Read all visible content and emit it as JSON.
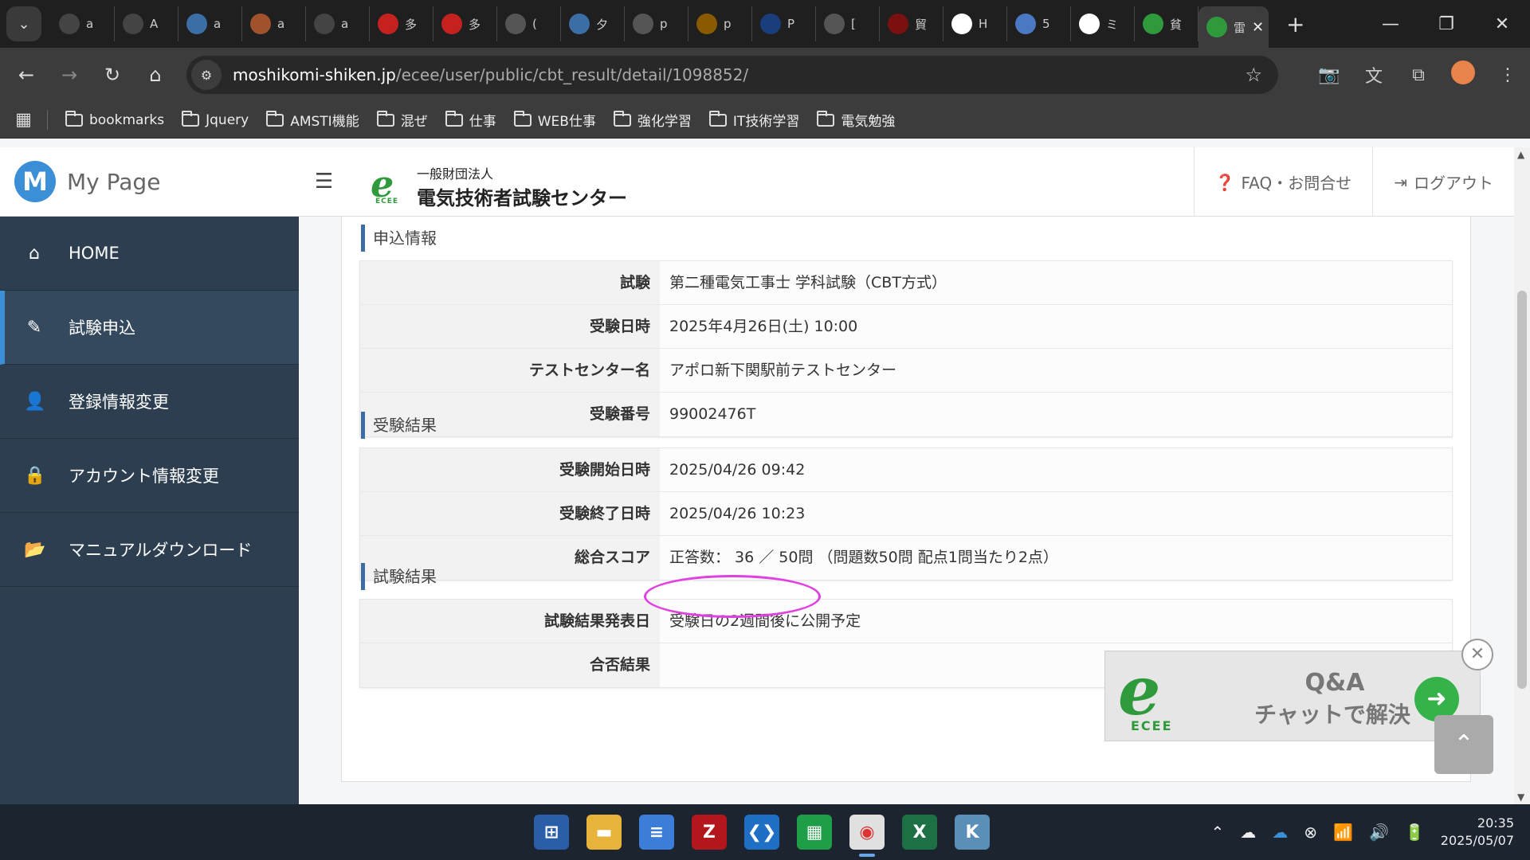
{
  "browser": {
    "tabs": [
      {
        "letter": "a",
        "icon": "threads-icon",
        "bg": "#444"
      },
      {
        "letter": "A",
        "icon": "threads-icon",
        "bg": "#444"
      },
      {
        "letter": "a",
        "icon": "wordpress-icon",
        "bg": "#3a6ea5"
      },
      {
        "letter": "a",
        "icon": "bicycle-icon",
        "bg": "#a0522d"
      },
      {
        "letter": "a",
        "icon": "threads-icon",
        "bg": "#444"
      },
      {
        "letter": "多",
        "icon": "gmail-icon",
        "bg": "#c5221f"
      },
      {
        "letter": "多",
        "icon": "gmail-icon",
        "bg": "#c5221f"
      },
      {
        "letter": "(",
        "icon": "globe-icon",
        "bg": "#555"
      },
      {
        "letter": "夕",
        "icon": "wordpress-icon",
        "bg": "#3a6ea5"
      },
      {
        "letter": "p",
        "icon": "globe-icon",
        "bg": "#555"
      },
      {
        "letter": "p",
        "icon": "mountain-icon",
        "bg": "#8a5a00"
      },
      {
        "letter": "P",
        "icon": "tp-icon",
        "bg": "#1a3d7c"
      },
      {
        "letter": "[",
        "icon": "globe-icon",
        "bg": "#555"
      },
      {
        "letter": "貿",
        "icon": "triangle-icon",
        "bg": "#7a1010"
      },
      {
        "letter": "H",
        "icon": "google-icon",
        "bg": "#fff"
      },
      {
        "letter": "5",
        "icon": "calendar-icon",
        "bg": "#4a78c2"
      },
      {
        "letter": "ミ",
        "icon": "amazon-icon",
        "bg": "#fff"
      },
      {
        "letter": "貧",
        "icon": "ecce-icon",
        "bg": "#2e9a3c"
      },
      {
        "letter": "雷",
        "icon": "ecce-icon",
        "bg": "#2e9a3c"
      }
    ],
    "url_host": "moshikomi-shiken.jp",
    "url_path": "/ecee/user/public/cbt_result/detail/1098852/",
    "bookmarks": [
      "bookmarks",
      "Jquery",
      "AMSTI機能",
      "混ぜ",
      "仕事",
      "WEB仕事",
      "強化学習",
      "IT技術学習",
      "電気勉強"
    ]
  },
  "sidebar": {
    "brand_letter": "M",
    "brand": "My Page",
    "items": [
      {
        "label": "HOME",
        "icon": "home-icon",
        "glyph": "⌂",
        "active": false
      },
      {
        "label": "試験申込",
        "icon": "pencil-icon",
        "glyph": "✎",
        "active": true
      },
      {
        "label": "登録情報変更",
        "icon": "user-icon",
        "glyph": "👤",
        "active": false
      },
      {
        "label": "アカウント情報変更",
        "icon": "lock-icon",
        "glyph": "🔒",
        "active": false
      },
      {
        "label": "マニュアルダウンロード",
        "icon": "folder-open-icon",
        "glyph": "📂",
        "active": false
      }
    ]
  },
  "header": {
    "org_sub": "一般財団法人",
    "org_main": "電気技術者試験センター",
    "org_abbr": "ECEE",
    "faq": "FAQ・お問合せ",
    "logout": "ログアウト"
  },
  "sections": [
    {
      "title": "申込情報",
      "rows": [
        {
          "label": "試験",
          "value": "第二種電気工事士 学科試験（CBT方式）"
        },
        {
          "label": "受験日時",
          "value": "2025年4月26日(土) 10:00"
        },
        {
          "label": "テストセンター名",
          "value": "アポロ新下関駅前テストセンター"
        },
        {
          "label": "受験番号",
          "value": "99002476T"
        }
      ]
    },
    {
      "title": "受験結果",
      "rows": [
        {
          "label": "受験開始日時",
          "value": "2025/04/26 09:42"
        },
        {
          "label": "受験終了日時",
          "value": "2025/04/26 10:23"
        },
        {
          "label": "総合スコア",
          "value": "正答数： 36 ／ 50問 （問題数50問 配点1問当たり2点）"
        }
      ]
    },
    {
      "title": "試験結果",
      "rows": [
        {
          "label": "試験結果発表日",
          "value": "受験日の2週間後に公開予定"
        },
        {
          "label": "合否結果",
          "value": ""
        }
      ]
    }
  ],
  "chat": {
    "abbr": "ECEE",
    "line1": "Q&A",
    "line2": "チャットで解決"
  },
  "taskbar": {
    "time": "20:35",
    "date": "2025/05/07"
  },
  "colors": {
    "sidebar_bg": "#2c3e50",
    "accent": "#3a8fd6",
    "highlight_ellipse": "#e040e0",
    "ecee_green": "#2e9a3c"
  }
}
